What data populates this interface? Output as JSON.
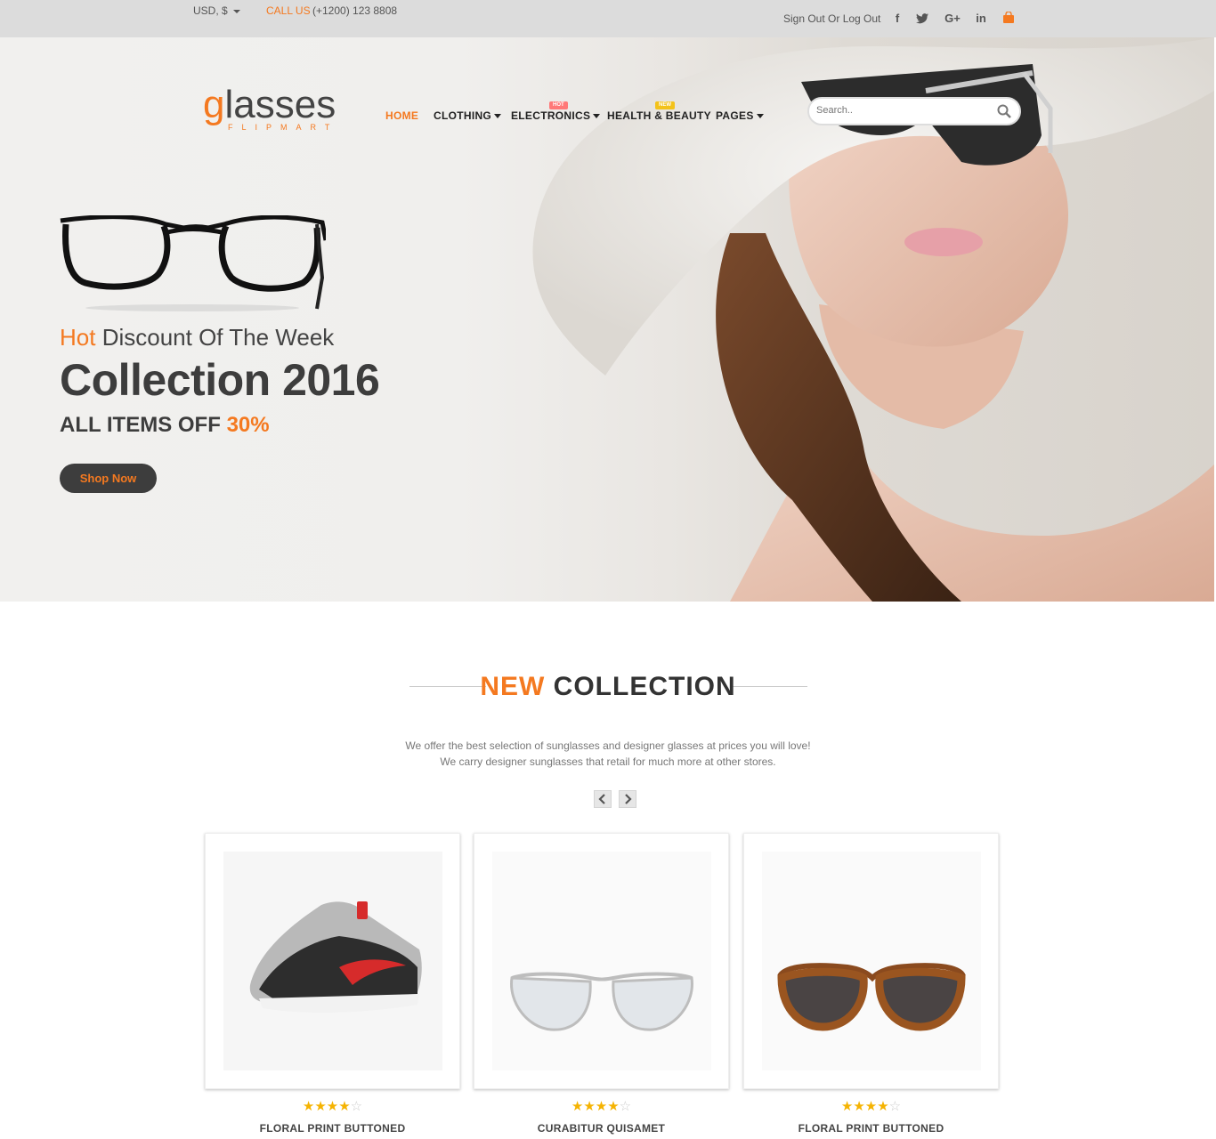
{
  "topbar": {
    "currency": "USD, $",
    "call_label": "CALL US",
    "call_number": "(+1200) 123 8808",
    "sign_link": "Sign Out Or Log Out",
    "social": {
      "facebook": "f",
      "twitter": "t",
      "google": "G+",
      "linkedin": "in"
    }
  },
  "header": {
    "logo_word": "lasses",
    "logo_g": "g",
    "logo_sub": "FLIPMART",
    "nav": [
      {
        "label": "HOME"
      },
      {
        "label": "CLOTHING"
      },
      {
        "label": "ELECTRONICS",
        "badge": "HOT"
      },
      {
        "label": "HEALTH & BEAUTY",
        "badge": "NEW"
      },
      {
        "label": "PAGES"
      }
    ],
    "search_placeholder": "Search.."
  },
  "hero": {
    "line1_accent": "Hot",
    "line1_rest": "Discount Of The Week",
    "title": "Collection 2016",
    "sub_prefix": "ALL ITEMS OFF",
    "sub_pct": "30%",
    "button": "Shop Now"
  },
  "collection": {
    "title_accent": "NEW",
    "title_rest": "COLLECTION",
    "desc_line1": "We offer the best selection of sunglasses and designer glasses at prices you will love!",
    "desc_line2": "We carry designer sunglasses that retail for much more at other stores.",
    "products": [
      {
        "name": "FLORAL PRINT BUTTONED",
        "rating": 4,
        "image": "sneaker-image"
      },
      {
        "name": "CURABITUR QUISAMET",
        "rating": 4,
        "image": "mirrored-sunglasses-image"
      },
      {
        "name": "FLORAL PRINT BUTTONED",
        "rating": 4,
        "image": "tortoise-sunglasses-image"
      }
    ]
  },
  "colors": {
    "accent": "#f47920",
    "dark": "#3d3d3d",
    "hot_badge": "#ff7878",
    "new_badge": "#f3c21a"
  }
}
